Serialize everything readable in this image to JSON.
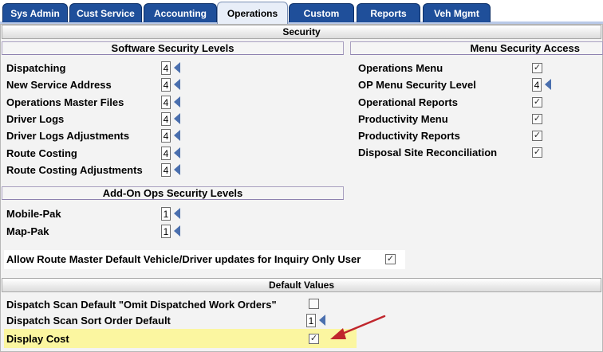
{
  "tabs": [
    {
      "label": "Sys Admin"
    },
    {
      "label": "Cust Service"
    },
    {
      "label": "Accounting"
    },
    {
      "label": "Operations"
    },
    {
      "label": "Custom"
    },
    {
      "label": "Reports"
    },
    {
      "label": "Veh Mgmt"
    }
  ],
  "security": {
    "header": "Security",
    "software_header": "Software Security Levels",
    "menu_header": "Menu Security Access",
    "software_levels": [
      {
        "label": "Dispatching",
        "value": "4"
      },
      {
        "label": "New Service Address",
        "value": "4"
      },
      {
        "label": "Operations Master Files",
        "value": "4"
      },
      {
        "label": "Driver Logs",
        "value": "4"
      },
      {
        "label": "Driver Logs Adjustments",
        "value": "4"
      },
      {
        "label": "Route Costing",
        "value": "4"
      },
      {
        "label": "Route Costing Adjustments",
        "value": "4"
      }
    ],
    "menu_access": {
      "operations_menu": "Operations Menu",
      "op_menu_security_level": "OP Menu Security Level",
      "op_menu_security_value": "4",
      "operational_reports": "Operational Reports",
      "productivity_menu": "Productivity Menu",
      "productivity_reports": "Productivity Reports",
      "disposal_site_reconciliation": "Disposal Site Reconciliation"
    },
    "addon_header": "Add-On Ops Security Levels",
    "addon_levels": [
      {
        "label": "Mobile-Pak",
        "value": "1"
      },
      {
        "label": "Map-Pak",
        "value": "1"
      }
    ],
    "allow_route_master": "Allow Route Master Default Vehicle/Driver updates for Inquiry Only User"
  },
  "defaults": {
    "header": "Default Values",
    "omit_dispatched": "Dispatch Scan Default \"Omit Dispatched Work Orders\"",
    "sort_order": "Dispatch Scan Sort Order Default",
    "sort_order_value": "1",
    "display_cost": "Display Cost"
  },
  "colors": {
    "tab_bg": "#1f4f9a",
    "tab_active_bg": "#e8eef8",
    "highlight": "#fbf6a0",
    "arrow": "#c0262d"
  },
  "check_glyph": "✓"
}
